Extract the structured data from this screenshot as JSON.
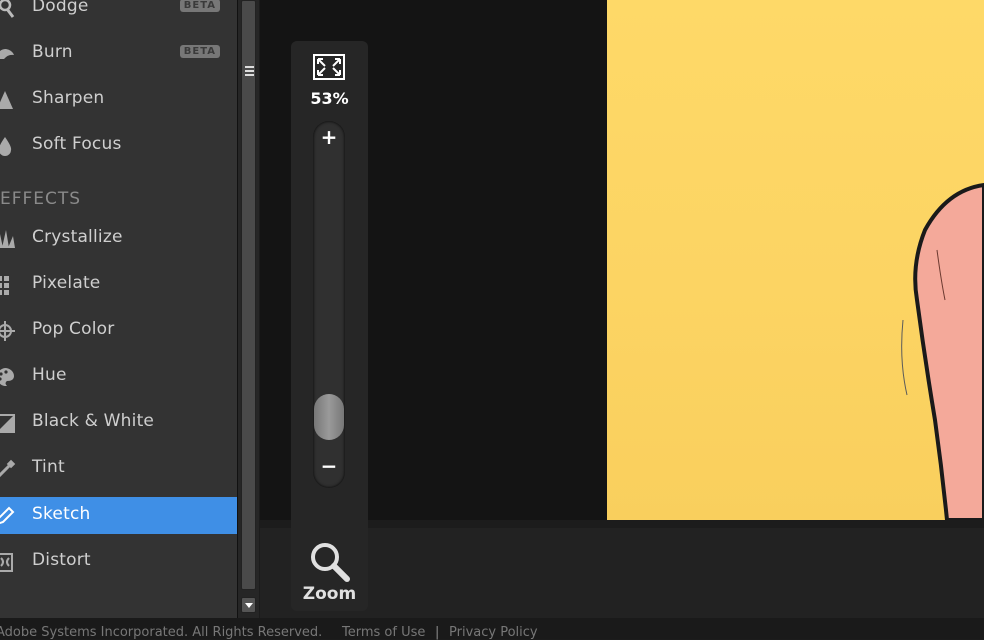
{
  "sidebar": {
    "items": [
      {
        "label": "Dodge",
        "badge": "BETA"
      },
      {
        "label": "Burn",
        "badge": "BETA"
      },
      {
        "label": "Sharpen"
      },
      {
        "label": "Soft Focus"
      },
      {
        "label": "Crystallize"
      },
      {
        "label": "Pixelate"
      },
      {
        "label": "Pop Color"
      },
      {
        "label": "Hue"
      },
      {
        "label": "Black & White"
      },
      {
        "label": "Tint"
      },
      {
        "label": "Sketch",
        "selected": true
      },
      {
        "label": "Distort"
      }
    ],
    "section_effects": "EFFECTS"
  },
  "zoom": {
    "percent": "53%",
    "plus": "+",
    "minus": "−",
    "label": "Zoom",
    "level_fraction": 0.1
  },
  "footer": {
    "copyright": "Adobe Systems Incorporated. All Rights Reserved.",
    "separator": "|",
    "terms": "Terms of Use",
    "privacy": "Privacy Policy"
  },
  "colors": {
    "selected": "#3f8fe6",
    "sidebar_bg": "#333333",
    "photo_bg": "#fed968"
  },
  "icons": {
    "dodge": "dodge-icon",
    "burn": "burn-icon",
    "sharpen": "sharpen-icon",
    "soft_focus": "droplet-icon",
    "crystallize": "crystallize-icon",
    "pixelate": "pixelate-icon",
    "pop_color": "crosshair-icon",
    "hue": "palette-icon",
    "black_white": "contrast-icon",
    "tint": "dropper-icon",
    "sketch": "pencil-icon",
    "distort": "distort-icon",
    "fit": "fit-screen-icon",
    "zoom": "magnifier-icon"
  }
}
